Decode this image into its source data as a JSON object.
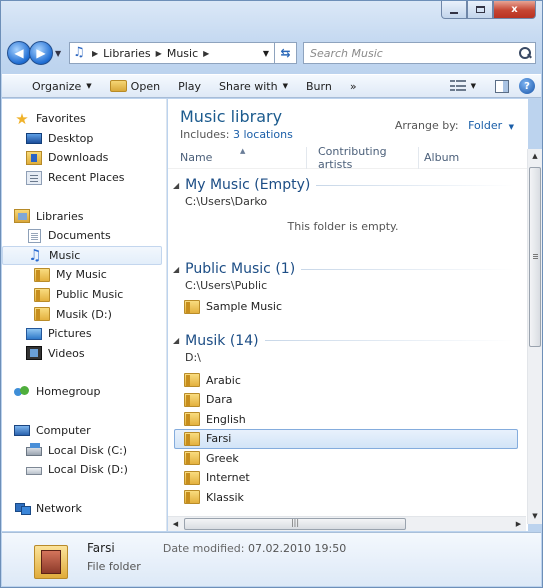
{
  "window": {
    "caption": {
      "minimize": "",
      "maximize": "",
      "close": "x"
    }
  },
  "address": {
    "crumbs": [
      "Libraries",
      "Music"
    ],
    "search_placeholder": "Search Music"
  },
  "toolbar": {
    "organize": "Organize",
    "open": "Open",
    "play": "Play",
    "share_with": "Share with",
    "burn": "Burn",
    "more": "»"
  },
  "navigation": {
    "favorites": "Favorites",
    "desktop": "Desktop",
    "downloads": "Downloads",
    "recent_places": "Recent Places",
    "libraries": "Libraries",
    "documents": "Documents",
    "music": "Music",
    "my_music": "My Music",
    "public_music": "Public Music",
    "musik_d": "Musik (D:)",
    "pictures": "Pictures",
    "videos": "Videos",
    "homegroup": "Homegroup",
    "computer": "Computer",
    "local_disk_c": "Local Disk (C:)",
    "local_disk_d": "Local Disk (D:)",
    "network": "Network"
  },
  "library": {
    "title": "Music library",
    "includes_label": "Includes:",
    "includes_link": "3 locations",
    "arrange_label": "Arrange by:",
    "arrange_value": "Folder"
  },
  "columns": {
    "name": "Name",
    "artists": "Contributing artists",
    "album": "Album"
  },
  "groups": [
    {
      "title": "My Music (Empty)",
      "path": "C:\\Users\\Darko",
      "empty": "This folder is empty.",
      "items": []
    },
    {
      "title": "Public Music (1)",
      "path": "C:\\Users\\Public",
      "items": [
        "Sample Music"
      ]
    },
    {
      "title": "Musik (14)",
      "path": "D:\\",
      "items": [
        "Arabic",
        "Dara",
        "English",
        "Farsi",
        "Greek",
        "Internet",
        "Klassik"
      ]
    }
  ],
  "selected_item": "Farsi",
  "details": {
    "name": "Farsi",
    "type": "File folder",
    "modified_label": "Date modified:",
    "modified_value": "07.02.2010 19:50"
  },
  "colors": {
    "accent": "#1c5b8e",
    "selection": "#d2e4f7",
    "link": "#1a5ea8"
  },
  "icons": {
    "back": "back-arrow-icon",
    "forward": "forward-arrow-icon",
    "refresh": "refresh-icon",
    "search": "search-icon",
    "help": "help-icon",
    "folder": "folder-icon",
    "music": "music-note-icon"
  }
}
